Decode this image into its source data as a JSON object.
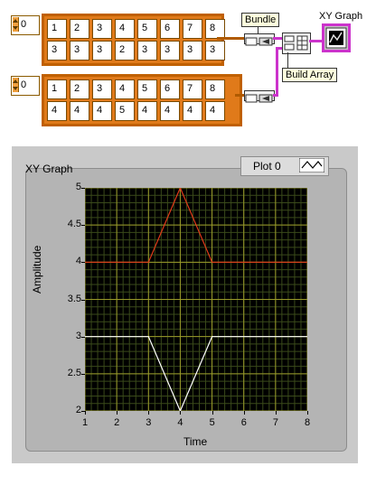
{
  "block_diagram": {
    "array1": {
      "index": "0",
      "row1": [
        "1",
        "2",
        "3",
        "4",
        "5",
        "6",
        "7",
        "8"
      ],
      "row2": [
        "3",
        "3",
        "3",
        "2",
        "3",
        "3",
        "3",
        "3"
      ]
    },
    "array2": {
      "index": "0",
      "row1": [
        "1",
        "2",
        "3",
        "4",
        "5",
        "6",
        "7",
        "8"
      ],
      "row2": [
        "4",
        "4",
        "4",
        "5",
        "4",
        "4",
        "4",
        "4"
      ]
    },
    "bundle_label": "Bundle",
    "build_array_label": "Build Array",
    "xy_graph_terminal_label": "XY Graph"
  },
  "front_panel": {
    "graph_label": "XY Graph",
    "legend": {
      "plot_name": "Plot 0"
    },
    "x_axis_label": "Time",
    "y_axis_label": "Amplitude",
    "x_ticks": [
      "1",
      "2",
      "3",
      "4",
      "5",
      "6",
      "7",
      "8"
    ],
    "y_ticks": [
      "5",
      "4.5",
      "4",
      "3.5",
      "3",
      "2.5",
      "2"
    ]
  },
  "chart_data": {
    "type": "line",
    "title": "XY Graph",
    "xlabel": "Time",
    "ylabel": "Amplitude",
    "xlim": [
      1,
      8
    ],
    "ylim": [
      2,
      5
    ],
    "grid": true,
    "series": [
      {
        "x": [
          1,
          2,
          3,
          4,
          5,
          6,
          7,
          8
        ],
        "y": [
          3,
          3,
          3,
          2,
          3,
          3,
          3,
          3
        ],
        "color": "#ffffff"
      },
      {
        "x": [
          1,
          2,
          3,
          4,
          5,
          6,
          7,
          8
        ],
        "y": [
          4,
          4,
          4,
          5,
          4,
          4,
          4,
          4
        ],
        "color": "#e03a1a"
      }
    ]
  }
}
